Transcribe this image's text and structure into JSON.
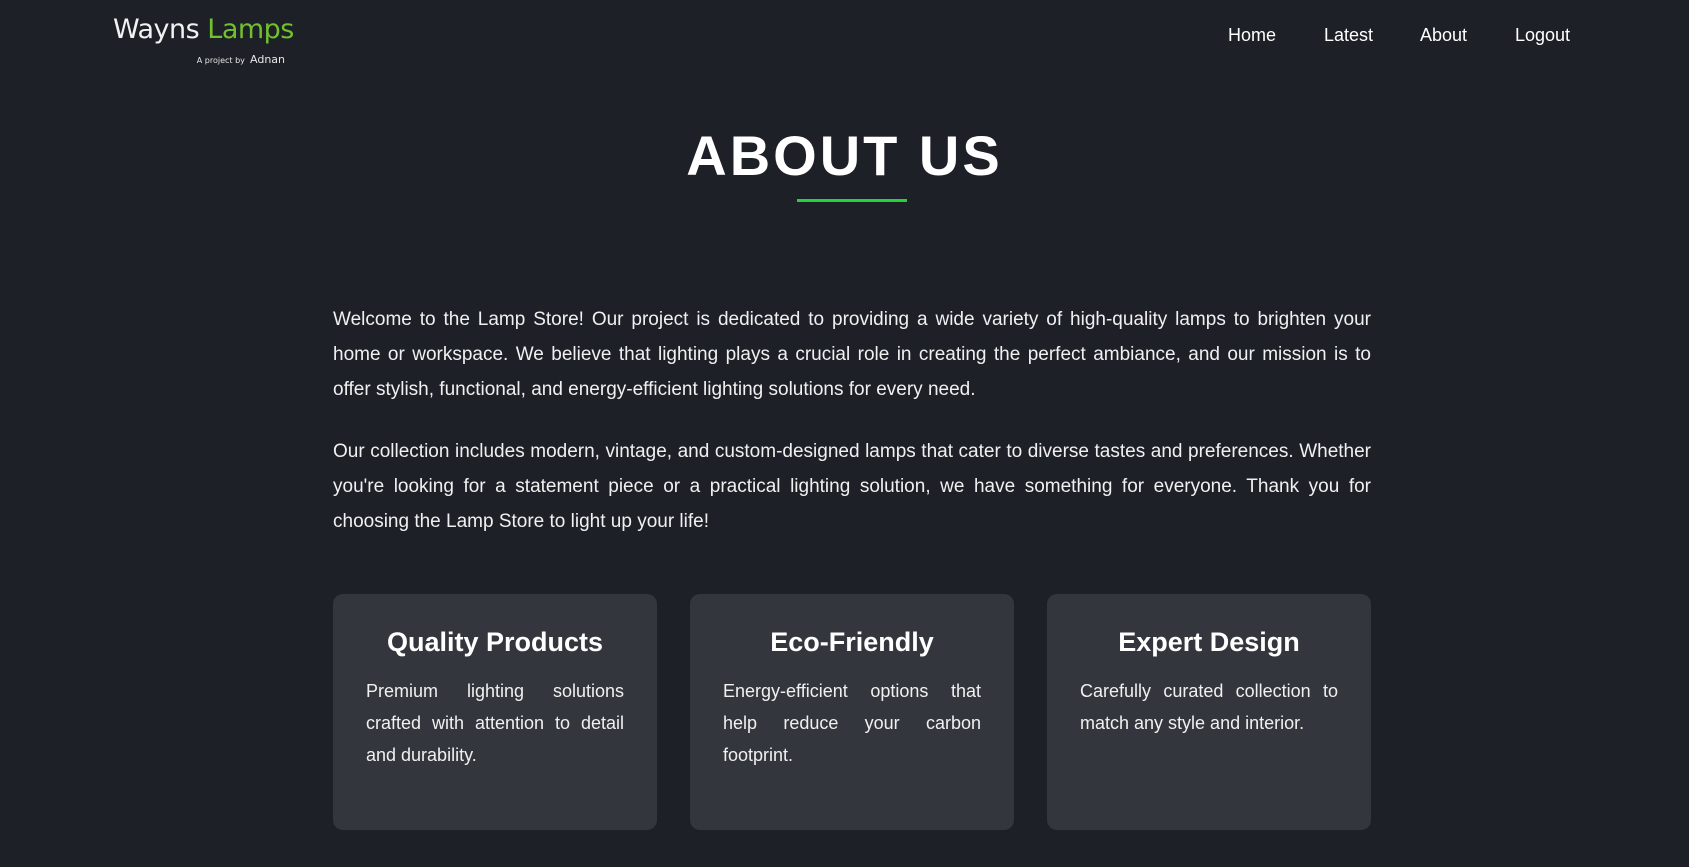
{
  "brand": {
    "name_part1": "Wayns",
    "name_part2": "Lamps",
    "tagline_prefix": "A project by",
    "tagline_author": "Adnan",
    "accent_color": "#72c02c"
  },
  "nav": {
    "items": [
      {
        "label": "Home"
      },
      {
        "label": "Latest"
      },
      {
        "label": "About"
      },
      {
        "label": "Logout"
      }
    ]
  },
  "page": {
    "title": "ABOUT US",
    "underline_color": "#22d43a",
    "paragraphs": [
      "Welcome to the Lamp Store! Our project is dedicated to providing a wide variety of high-quality lamps to brighten your home or workspace. We believe that lighting plays a crucial role in creating the perfect ambiance, and our mission is to offer stylish, functional, and energy-efficient lighting solutions for every need.",
      "Our collection includes modern, vintage, and custom-designed lamps that cater to diverse tastes and preferences. Whether you're looking for a statement piece or a practical lighting solution, we have something for everyone. Thank you for choosing the Lamp Store to light up your life!"
    ]
  },
  "features": [
    {
      "title": "Quality Products",
      "text": "Premium lighting solutions crafted with attention to detail and durability."
    },
    {
      "title": "Eco-Friendly",
      "text": "Energy-efficient options that help reduce your carbon footprint."
    },
    {
      "title": "Expert Design",
      "text": "Carefully curated collection to match any style and interior."
    }
  ]
}
